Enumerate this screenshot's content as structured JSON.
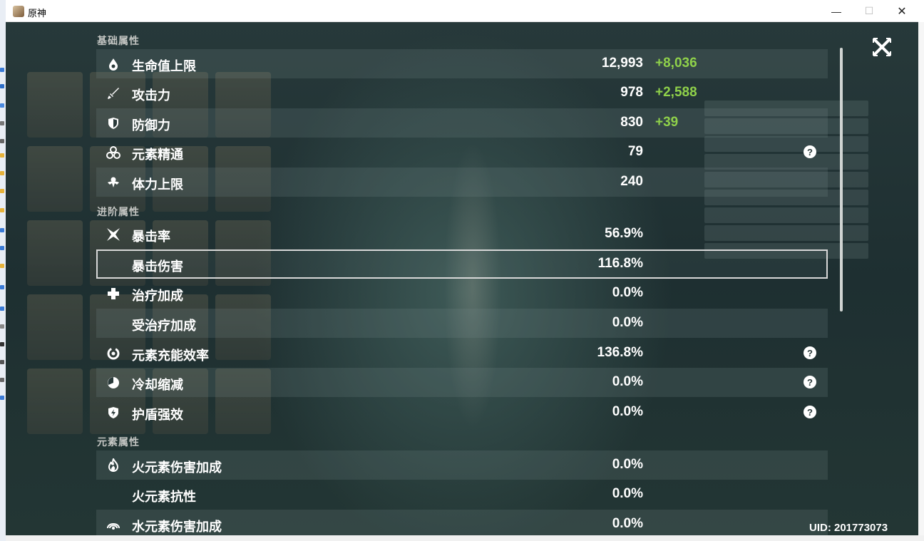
{
  "window": {
    "title": "原神"
  },
  "sections": {
    "basic": "基础属性",
    "advanced": "进阶属性",
    "elemental": "元素属性"
  },
  "stats": [
    {
      "id": "hp",
      "name": "生命值上限",
      "value": "12,993",
      "bonus": "+8,036",
      "icon": "hp-drop-icon",
      "help": false
    },
    {
      "id": "atk",
      "name": "攻击力",
      "value": "978",
      "bonus": "+2,588",
      "icon": "sword-icon",
      "help": false
    },
    {
      "id": "def",
      "name": "防御力",
      "value": "830",
      "bonus": "+39",
      "icon": "shield-icon",
      "help": false
    },
    {
      "id": "em",
      "name": "元素精通",
      "value": "79",
      "bonus": "",
      "icon": "element-mastery-icon",
      "help": true
    },
    {
      "id": "stamina",
      "name": "体力上限",
      "value": "240",
      "bonus": "",
      "icon": "stamina-icon",
      "help": false
    },
    {
      "id": "crit-rate",
      "name": "暴击率",
      "value": "56.9%",
      "bonus": "",
      "icon": "crit-rate-icon",
      "help": false
    },
    {
      "id": "crit-dmg",
      "name": "暴击伤害",
      "value": "116.8%",
      "bonus": "",
      "icon": "",
      "help": false
    },
    {
      "id": "heal",
      "name": "治疗加成",
      "value": "0.0%",
      "bonus": "",
      "icon": "healing-cross-icon",
      "help": false
    },
    {
      "id": "incoming-heal",
      "name": "受治疗加成",
      "value": "0.0%",
      "bonus": "",
      "icon": "",
      "help": false
    },
    {
      "id": "er",
      "name": "元素充能效率",
      "value": "136.8%",
      "bonus": "",
      "icon": "energy-recharge-icon",
      "help": true
    },
    {
      "id": "cdr",
      "name": "冷却缩减",
      "value": "0.0%",
      "bonus": "",
      "icon": "cooldown-icon",
      "help": true
    },
    {
      "id": "shield",
      "name": "护盾强效",
      "value": "0.0%",
      "bonus": "",
      "icon": "shield-strength-icon",
      "help": true
    },
    {
      "id": "pyro-dmg",
      "name": "火元素伤害加成",
      "value": "0.0%",
      "bonus": "",
      "icon": "pyro-icon",
      "help": false
    },
    {
      "id": "pyro-res",
      "name": "火元素抗性",
      "value": "0.0%",
      "bonus": "",
      "icon": "",
      "help": false
    },
    {
      "id": "hydro-dmg",
      "name": "水元素伤害加成",
      "value": "0.0%",
      "bonus": "",
      "icon": "hydro-icon",
      "help": false
    }
  ],
  "help_glyph": "?",
  "uid": "UID: 201773073",
  "colors": {
    "bonus": "#8fd14a",
    "text": "#ffffff",
    "section": "#c4c6c3"
  }
}
